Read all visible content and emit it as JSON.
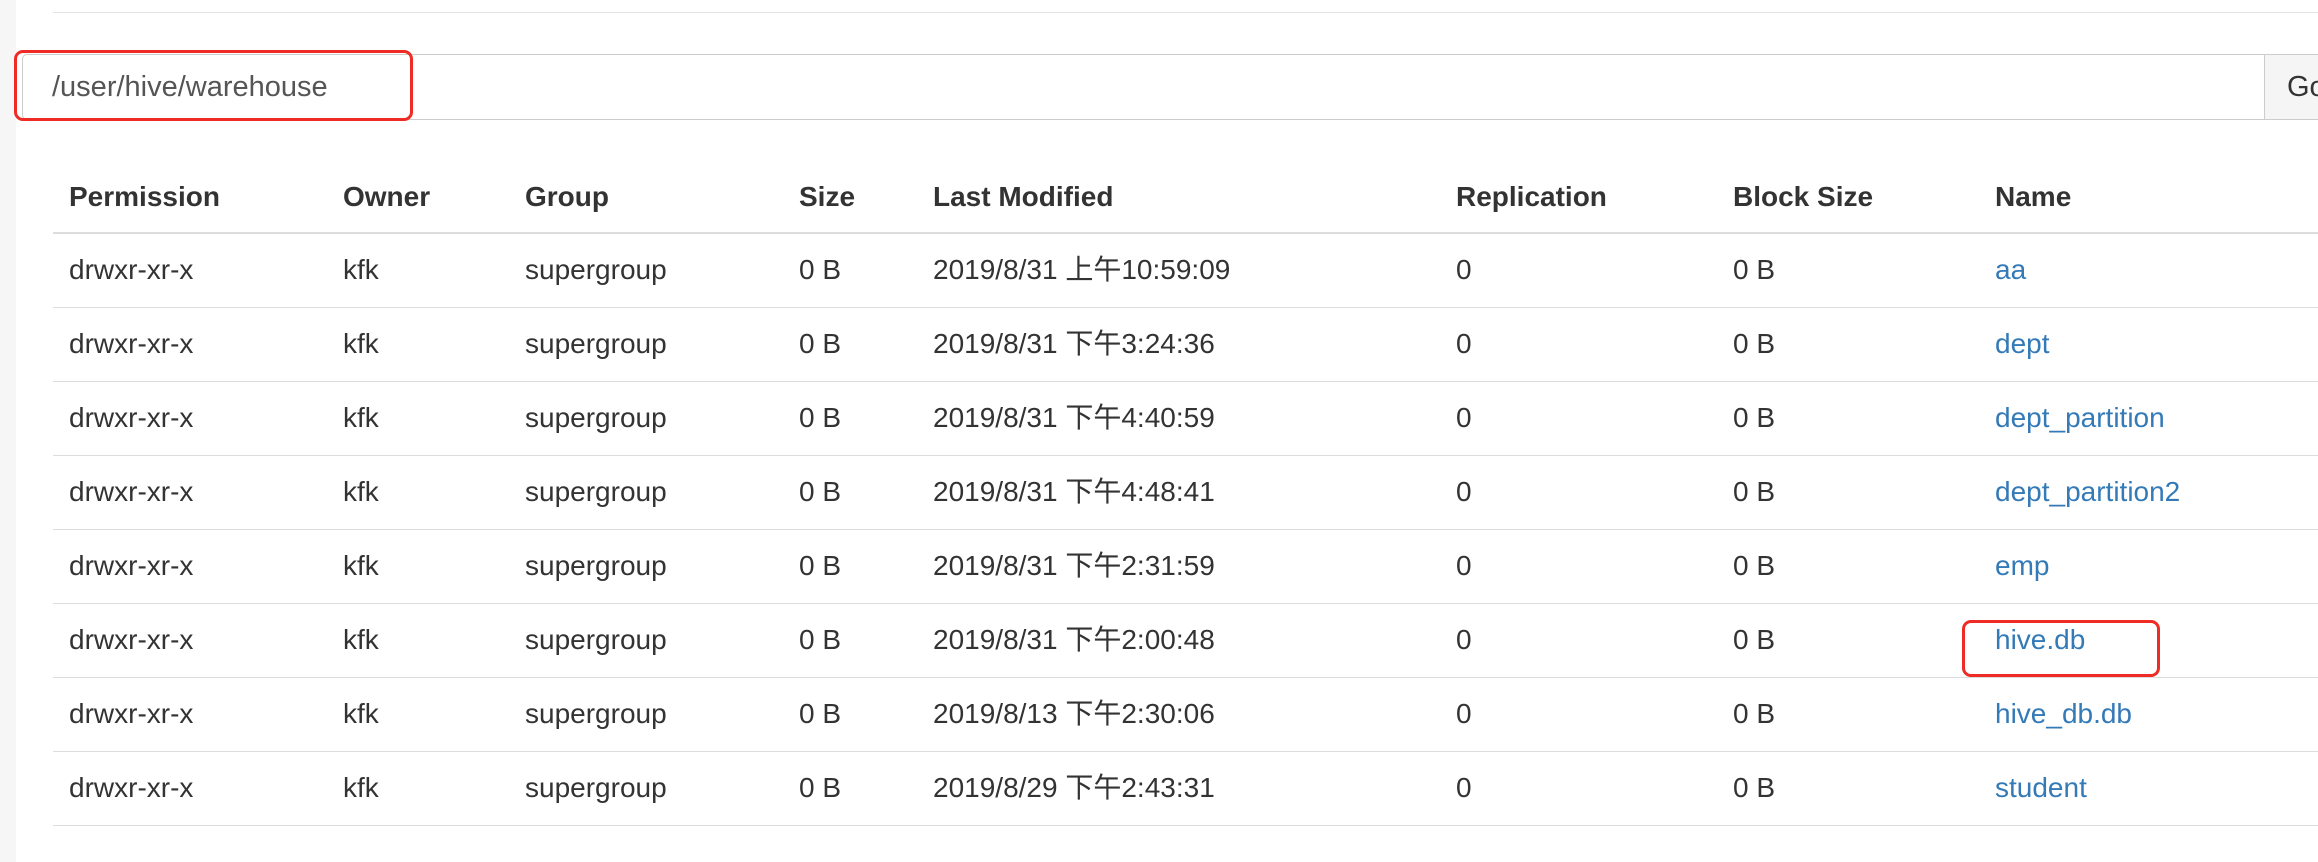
{
  "path_bar": {
    "value": "/user/hive/warehouse",
    "go_label": "Go!"
  },
  "colors": {
    "link": "#337ab7",
    "highlight_box": "#ee2b24",
    "border": "#dddddd"
  },
  "table": {
    "headers": {
      "permission": "Permission",
      "owner": "Owner",
      "group": "Group",
      "size": "Size",
      "last_modified": "Last Modified",
      "replication": "Replication",
      "block_size": "Block Size",
      "name": "Name"
    },
    "rows": [
      {
        "permission": "drwxr-xr-x",
        "owner": "kfk",
        "group": "supergroup",
        "size": "0 B",
        "last_modified": "2019/8/31 上午10:59:09",
        "replication": "0",
        "block_size": "0 B",
        "name": "aa"
      },
      {
        "permission": "drwxr-xr-x",
        "owner": "kfk",
        "group": "supergroup",
        "size": "0 B",
        "last_modified": "2019/8/31 下午3:24:36",
        "replication": "0",
        "block_size": "0 B",
        "name": "dept"
      },
      {
        "permission": "drwxr-xr-x",
        "owner": "kfk",
        "group": "supergroup",
        "size": "0 B",
        "last_modified": "2019/8/31 下午4:40:59",
        "replication": "0",
        "block_size": "0 B",
        "name": "dept_partition"
      },
      {
        "permission": "drwxr-xr-x",
        "owner": "kfk",
        "group": "supergroup",
        "size": "0 B",
        "last_modified": "2019/8/31 下午4:48:41",
        "replication": "0",
        "block_size": "0 B",
        "name": "dept_partition2"
      },
      {
        "permission": "drwxr-xr-x",
        "owner": "kfk",
        "group": "supergroup",
        "size": "0 B",
        "last_modified": "2019/8/31 下午2:31:59",
        "replication": "0",
        "block_size": "0 B",
        "name": "emp"
      },
      {
        "permission": "drwxr-xr-x",
        "owner": "kfk",
        "group": "supergroup",
        "size": "0 B",
        "last_modified": "2019/8/31 下午2:00:48",
        "replication": "0",
        "block_size": "0 B",
        "name": "hive.db"
      },
      {
        "permission": "drwxr-xr-x",
        "owner": "kfk",
        "group": "supergroup",
        "size": "0 B",
        "last_modified": "2019/8/13 下午2:30:06",
        "replication": "0",
        "block_size": "0 B",
        "name": "hive_db.db"
      },
      {
        "permission": "drwxr-xr-x",
        "owner": "kfk",
        "group": "supergroup",
        "size": "0 B",
        "last_modified": "2019/8/29 下午2:43:31",
        "replication": "0",
        "block_size": "0 B",
        "name": "student"
      }
    ]
  }
}
